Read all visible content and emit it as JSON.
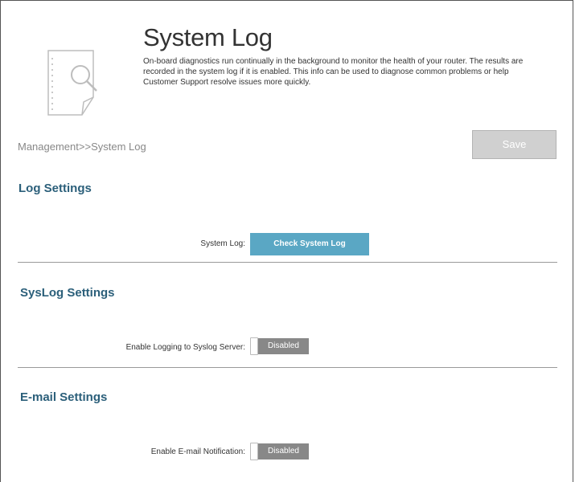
{
  "header": {
    "title": "System Log",
    "description": "On-board diagnostics run continually in the background to monitor the health of your router. The results are recorded in the system log if it is enabled. This info can be used to diagnose common problems or help Customer Support resolve issues more quickly.",
    "icon": "document-search-icon"
  },
  "breadcrumb": "Management>>System Log",
  "toolbar": {
    "save_label": "Save"
  },
  "log_settings": {
    "title": "Log Settings",
    "system_log_label": "System Log:",
    "check_button_label": "Check System Log"
  },
  "syslog_settings": {
    "title": "SysLog Settings",
    "enable_label": "Enable Logging to Syslog Server:",
    "enable_state": "Disabled"
  },
  "email_settings": {
    "title": "E-mail Settings",
    "enable_label": "Enable E-mail Notification:",
    "enable_state": "Disabled"
  },
  "colors": {
    "section_title": "#2b5f7a",
    "check_button": "#5aa7c4",
    "toggle_disabled": "#888888",
    "save_disabled": "#d0d0d0"
  }
}
